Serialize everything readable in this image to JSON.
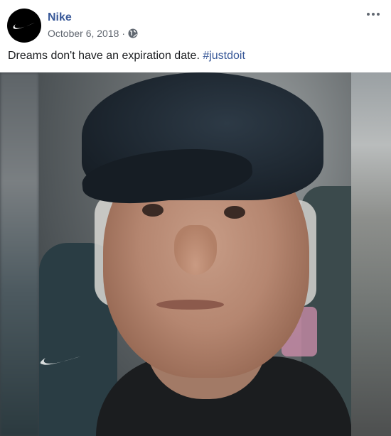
{
  "post": {
    "author": "Nike",
    "date": "October 6, 2018",
    "separator": "·",
    "privacy_icon": "globe-icon",
    "caption_text": "Dreams don't have an expiration date. ",
    "hashtag": "#justdoit",
    "avatar_icon": "nike-swoosh-icon",
    "more_icon": "more-options-icon"
  },
  "colors": {
    "author": "#385898",
    "hashtag": "#385898",
    "meta": "#616770",
    "text": "#1c1e21"
  }
}
